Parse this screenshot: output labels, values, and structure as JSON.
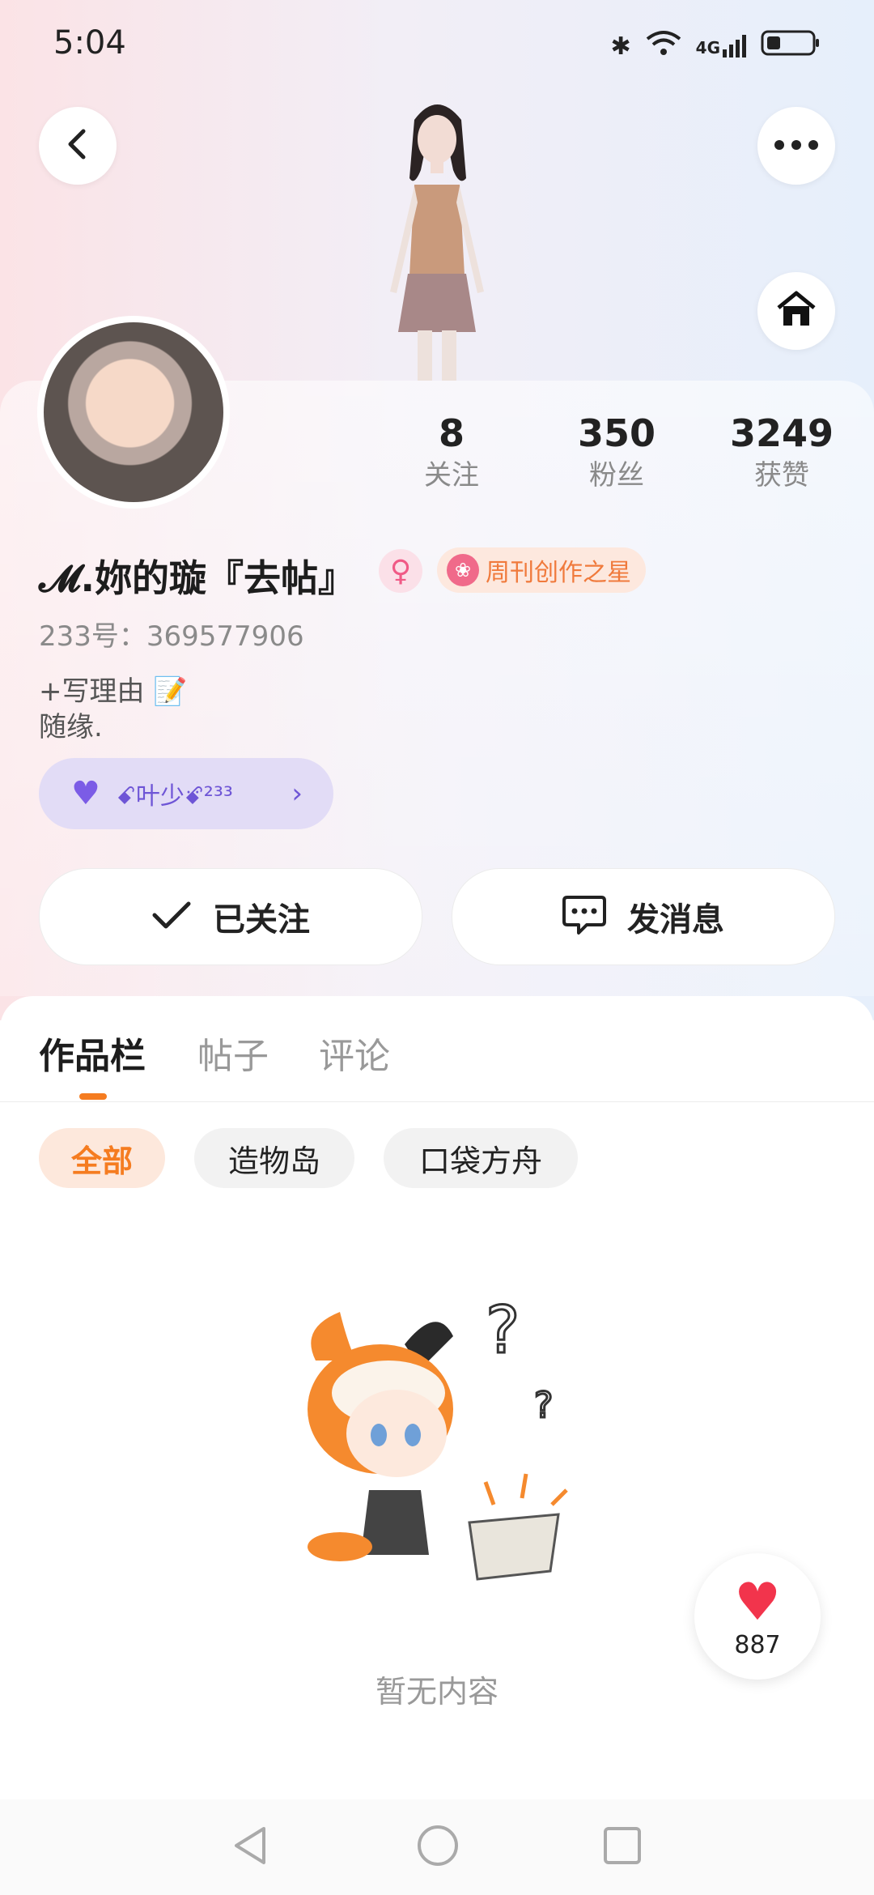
{
  "status_bar": {
    "time": "5:04",
    "battery_icon": "battery-icon",
    "signal_label": "4G"
  },
  "header": {
    "back_icon": "chevron-left-icon",
    "more_icon": "more-horizontal-icon",
    "home_icon": "home-icon"
  },
  "profile": {
    "stats": [
      {
        "value": "8",
        "label": "关注"
      },
      {
        "value": "350",
        "label": "粉丝"
      },
      {
        "value": "3249",
        "label": "获赞"
      }
    ],
    "name": "𝓜.妳的璇『去帖』",
    "gender_icon": "female-icon",
    "badge": "周刊创作之星",
    "id_line": "233号：369577906",
    "bio_line1": "+写理由 📝",
    "bio_line2": "随缘.",
    "friend_tag": "ꗃ叶少ꗄ²³³"
  },
  "actions": {
    "follow": "已关注",
    "message": "发消息"
  },
  "tabs": [
    "作品栏",
    "帖子",
    "评论"
  ],
  "filters": [
    "全部",
    "造物岛",
    "口袋方舟"
  ],
  "empty_text": "暂无内容",
  "like": {
    "count": "887"
  },
  "colors": {
    "accent": "#f57c20",
    "badge_text": "#f07a3c",
    "friend_bg": "#e2dcf6",
    "heart": "#f2344c"
  }
}
